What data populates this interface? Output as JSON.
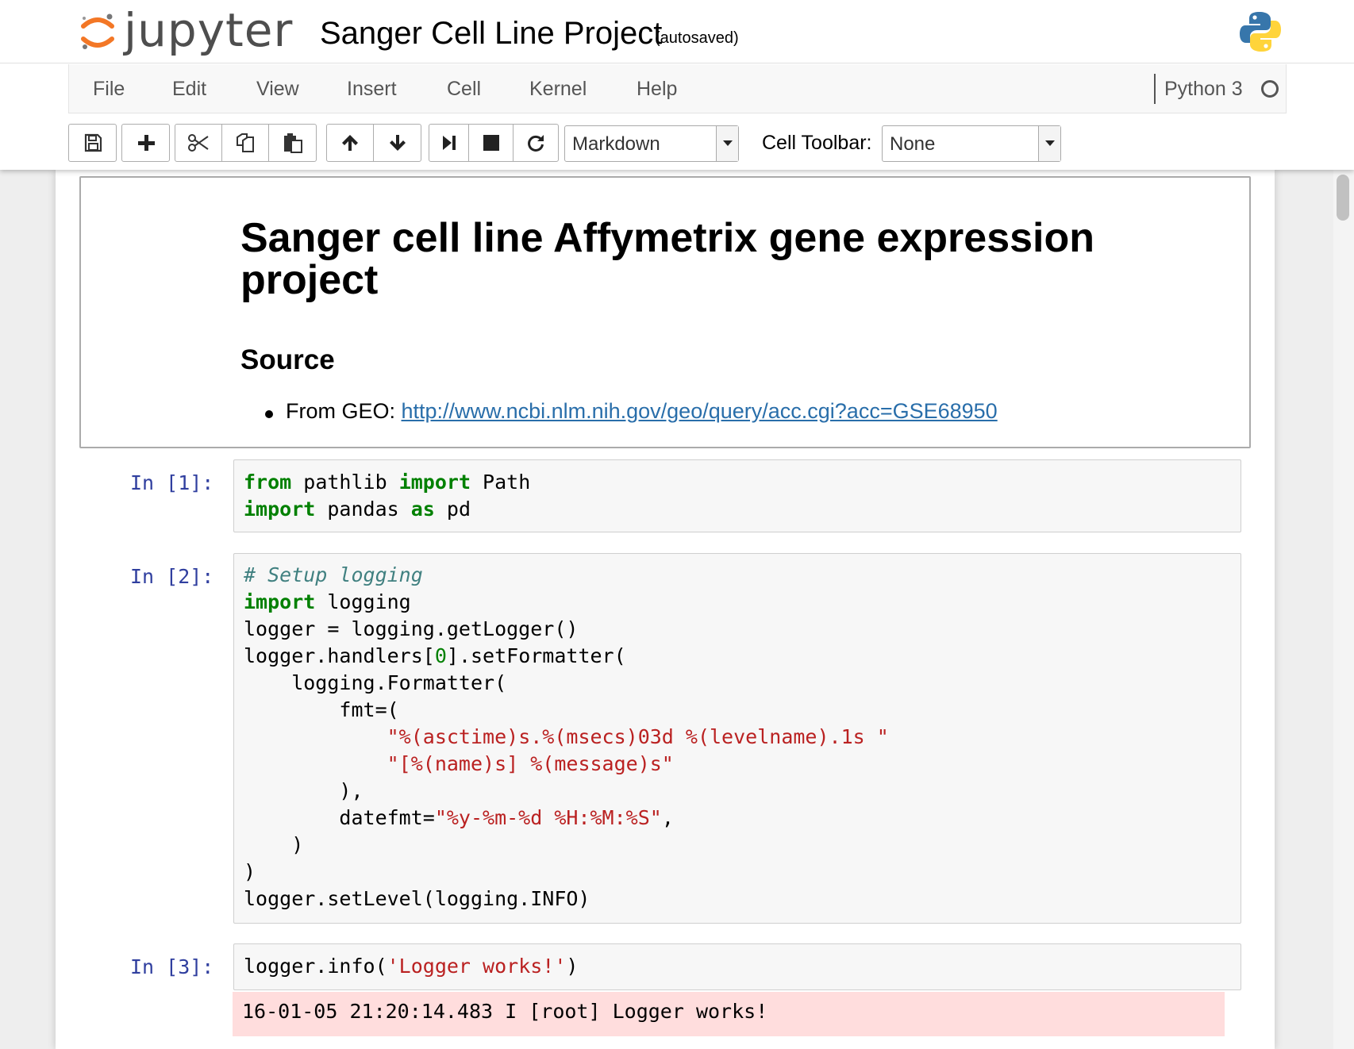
{
  "header": {
    "logo_text": "jupyter",
    "notebook_name": "Sanger Cell Line Project",
    "autosave_status": "(autosaved)",
    "kernel_logo_icon": "python-logo-icon"
  },
  "menubar": {
    "items": [
      "File",
      "Edit",
      "View",
      "Insert",
      "Cell",
      "Kernel",
      "Help"
    ],
    "kernel_name": "Python 3",
    "kernel_status_icon": "kernel-idle-circle-icon"
  },
  "toolbar": {
    "buttons": [
      "save-icon",
      "plus-icon",
      "cut-icon",
      "copy-icon",
      "paste-icon",
      "arrow-up-icon",
      "arrow-down-icon",
      "run-next-icon",
      "stop-icon",
      "restart-icon"
    ],
    "cell_type_selected": "Markdown",
    "cell_toolbar_label": "Cell Toolbar:",
    "cell_toolbar_selected": "None"
  },
  "markdown_cell": {
    "heading": "Sanger cell line Affymetrix gene expression project",
    "subheading": "Source",
    "list_prefix": "From GEO: ",
    "list_link": "http://www.ncbi.nlm.nih.gov/geo/query/acc.cgi?acc=GSE68950"
  },
  "cells": [
    {
      "prompt": "In [1]:"
    },
    {
      "prompt": "In [2]:"
    },
    {
      "prompt": "In [3]:",
      "output": "16-01-05 21:20:14.483 I [root] Logger works!"
    }
  ],
  "colors": {
    "prompt": "#303f9f",
    "keyword": "#008000",
    "string": "#ba2121",
    "comment": "#408080",
    "link": "#296eaa",
    "stderr_bg": "#ffdddd"
  }
}
